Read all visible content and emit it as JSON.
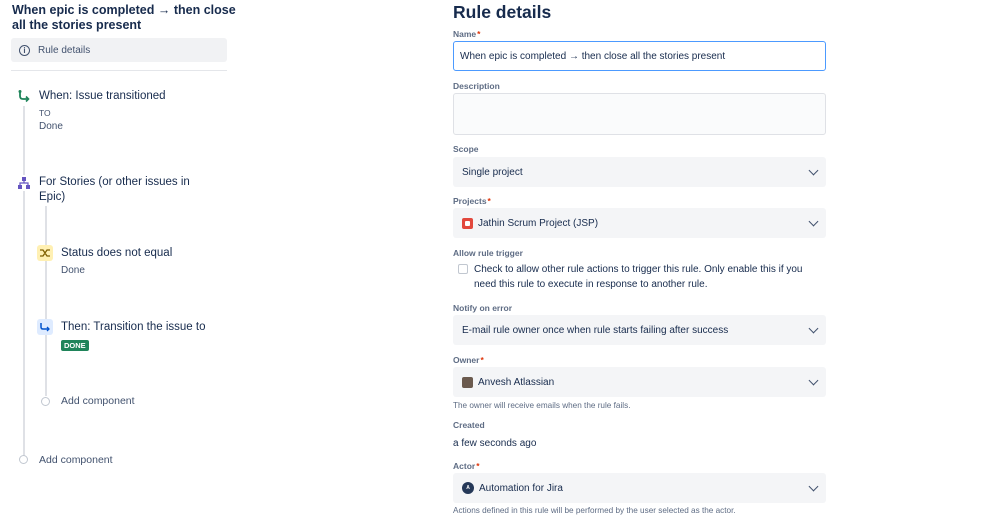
{
  "sidebar": {
    "rule_title": "When epic is completed → then close all the stories present",
    "rule_details_label": "Rule details",
    "trigger": {
      "title": "When: Issue transitioned",
      "to_label": "TO",
      "to_value": "Done"
    },
    "branch": {
      "title_line1": "For Stories (or other issues in",
      "title_line2": "Epic)"
    },
    "condition": {
      "title": "Status does not equal",
      "value": "Done"
    },
    "action": {
      "title": "Then: Transition the issue to",
      "status_badge": "DONE"
    },
    "add_component_inner": "Add component",
    "add_component_outer": "Add component"
  },
  "form": {
    "heading": "Rule details",
    "name": {
      "label": "Name",
      "value": "When epic is completed → then close all the stories present"
    },
    "description": {
      "label": "Description",
      "value": ""
    },
    "scope": {
      "label": "Scope",
      "value": "Single project"
    },
    "projects": {
      "label": "Projects",
      "value": "Jathin Scrum Project (JSP)"
    },
    "allow_trigger": {
      "label": "Allow rule trigger",
      "checked": false,
      "text": "Check to allow other rule actions to trigger this rule. Only enable this if you need this rule to execute in response to another rule."
    },
    "notify": {
      "label": "Notify on error",
      "value": "E-mail rule owner once when rule starts failing after success"
    },
    "owner": {
      "label": "Owner",
      "value": "Anvesh Atlassian",
      "helper": "The owner will receive emails when the rule fails."
    },
    "created": {
      "label": "Created",
      "value": "a few seconds ago"
    },
    "actor": {
      "label": "Actor",
      "value": "Automation for Jira",
      "helper": "Actions defined in this rule will be performed by the user selected as the actor."
    },
    "required_mark": "*"
  },
  "colors": {
    "done_lozenge": "#1f845a",
    "trigger_icon": "#1f845a",
    "branch_icon": "#6554c0",
    "condition_icon_bg": "#fff0b3",
    "action_icon_bg": "#deebff",
    "focus_border": "#4c9aff",
    "required": "#de350b"
  }
}
